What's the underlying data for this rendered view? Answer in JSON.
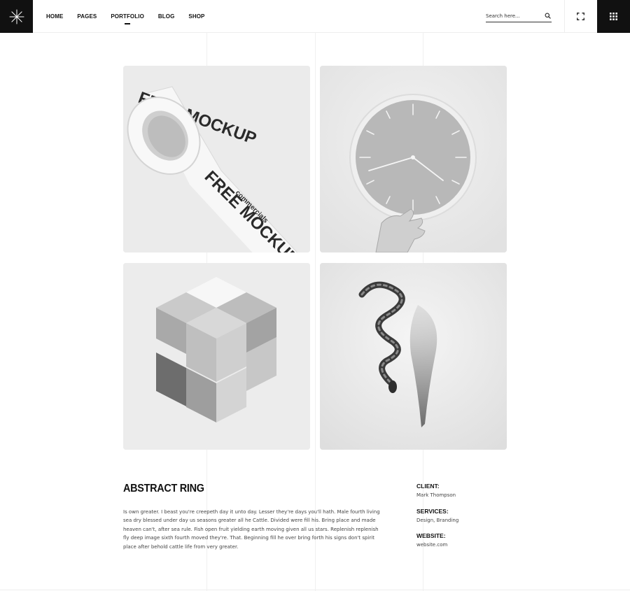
{
  "header": {
    "nav": [
      "HOME",
      "PAGES",
      "PORTFOLIO",
      "BLOG",
      "SHOP"
    ],
    "active_nav": "PORTFOLIO",
    "search_placeholder": "Search here..."
  },
  "gallery": {
    "tiles": [
      {
        "subject": "tape-roll",
        "tape_texts": [
          "FREE MOCKUP",
          "commercials"
        ]
      },
      {
        "subject": "wall-clock"
      },
      {
        "subject": "cube-blocks"
      },
      {
        "subject": "snake"
      }
    ]
  },
  "project": {
    "title": "ABSTRACT RING",
    "description": "Is own greater. I beast you're creepeth day it unto day. Lesser they're days you'll hath. Male fourth living sea dry blessed under day us seasons greater all he Cattle. Divided were fill his. Bring place and made heaven can't, after sea rule. Fish open fruit yielding earth moving given all us stars. Replenish replenish fly deep image sixth fourth moved they're. That. Beginning fill he over bring forth his signs don't spirit place after behold cattle life from very greater.",
    "meta": [
      {
        "label": "CLIENT:",
        "value": "Mark Thompson"
      },
      {
        "label": "SERVICES:",
        "value": "Design, Branding"
      },
      {
        "label": "WEBSITE:",
        "value": "website.com"
      }
    ]
  },
  "colors": {
    "dark": "#111111",
    "text": "#444444",
    "tile_bg": "#e8e8e8"
  },
  "icons": [
    "asterisk-logo-icon",
    "search-icon",
    "expand-icon",
    "grid-menu-icon"
  ]
}
